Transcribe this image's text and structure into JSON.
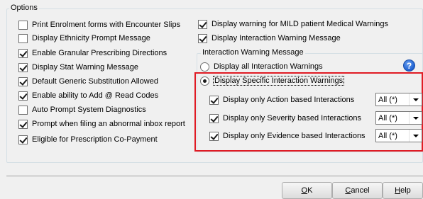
{
  "options_group": {
    "legend": "Options",
    "left_items": [
      {
        "label": "Print Enrolment forms with Encounter Slips",
        "checked": false
      },
      {
        "label": "Display Ethnicity Prompt Message",
        "checked": false
      },
      {
        "label": "Enable Granular Prescribing Directions",
        "checked": true
      },
      {
        "label": "Display Stat Warning Message",
        "checked": true
      },
      {
        "label": "Default Generic Substitution Allowed",
        "checked": true
      },
      {
        "label": "Enable ability to Add @ Read Codes",
        "checked": true
      },
      {
        "label": "Auto Prompt System Diagnostics",
        "checked": false
      },
      {
        "label": "Prompt when filing an abnormal inbox report",
        "checked": true
      },
      {
        "label": "Eligible for Prescription Co-Payment",
        "checked": true
      }
    ],
    "right_items": [
      {
        "label": "Display warning for MILD patient Medical Warnings",
        "checked": true
      },
      {
        "label": "Display Interaction Warning Message",
        "checked": true
      }
    ]
  },
  "interaction_group": {
    "legend": "Interaction Warning Message",
    "radio_all": {
      "label": "Display all Interaction Warnings",
      "selected": false
    },
    "radio_specific": {
      "label": "Display Specific Interaction Warnings",
      "selected": true
    },
    "filters": [
      {
        "label": "Display only Action based Interactions",
        "checked": true,
        "value": "All (*)"
      },
      {
        "label": "Display only Severity based Interactions",
        "checked": true,
        "value": "All (*)"
      },
      {
        "label": "Display only Evidence based Interactions",
        "checked": true,
        "value": "All (*)"
      }
    ],
    "help_glyph": "?"
  },
  "buttons": {
    "ok": {
      "accel": "O",
      "rest": "K"
    },
    "cancel": {
      "accel": "C",
      "rest": "ancel"
    },
    "help": {
      "accel": "H",
      "rest": "elp"
    }
  },
  "colors": {
    "highlight": "#e01b24",
    "background": "#f0f0f0"
  }
}
